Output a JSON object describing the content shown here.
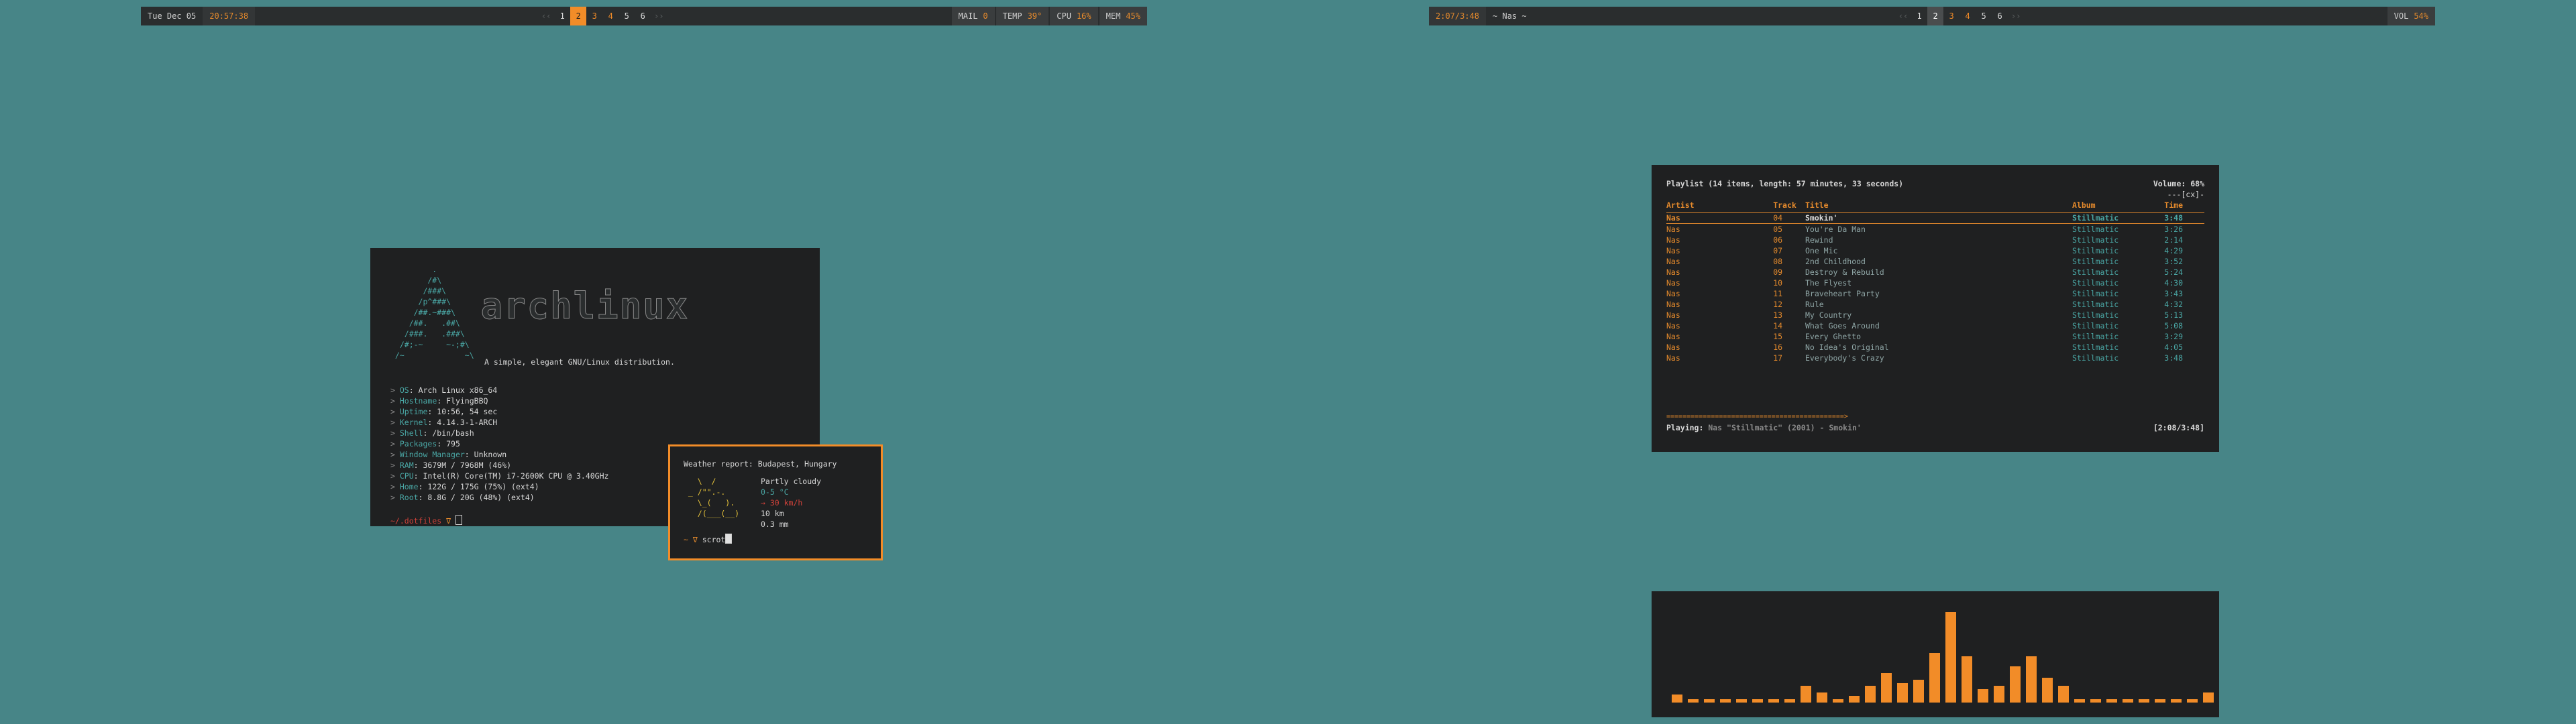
{
  "bar_left": {
    "date": "Tue Dec 05",
    "time": "20:57:38",
    "ws_left_arrow": "‹‹",
    "ws_right_arrow": "››",
    "workspaces": [
      "1",
      "2",
      "3",
      "4",
      "5",
      "6"
    ],
    "mail_label": "MAIL",
    "mail_value": "0",
    "temp_label": "TEMP",
    "temp_value": "39°",
    "cpu_label": "CPU",
    "cpu_value": "16%",
    "mem_label": "MEM",
    "mem_value": "45%"
  },
  "bar_right": {
    "track_time": "2:07/3:48",
    "title": "~ Nas ~",
    "ws_left_arrow": "‹‹",
    "ws_right_arrow": "››",
    "workspaces": [
      "1",
      "2",
      "3",
      "4",
      "5",
      "6"
    ],
    "vol_label": "VOL",
    "vol_value": "54%"
  },
  "neofetch": {
    "logo_text": "archlinux",
    "tagline": "A simple, elegant GNU/Linux distribution.",
    "info": [
      {
        "label": "OS",
        "value": "Arch Linux x86_64"
      },
      {
        "label": "Hostname",
        "value": "FlyingBBQ"
      },
      {
        "label": "Uptime",
        "value": "10:56, 54 sec"
      },
      {
        "label": "Kernel",
        "value": "4.14.3-1-ARCH"
      },
      {
        "label": "Shell",
        "value": "/bin/bash"
      },
      {
        "label": "Packages",
        "value": "795"
      },
      {
        "label": "Window Manager",
        "value": "Unknown"
      },
      {
        "label": "RAM",
        "value": "3679M / 7968M (46%)"
      },
      {
        "label": "CPU",
        "value": "Intel(R) Core(TM) i7-2600K CPU @ 3.40GHz"
      },
      {
        "label": "Home",
        "value": "122G / 175G (75%) (ext4)"
      },
      {
        "label": "Root",
        "value": "8.8G / 20G (48%) (ext4)"
      }
    ],
    "prompt_dir": "~/.dotfiles",
    "prompt_symbol": "∇"
  },
  "weather": {
    "title": "Weather report: Budapest, Hungary",
    "condition": "Partly cloudy",
    "temp": "0-5 °C",
    "wind": "→ 30 km/h",
    "visibility": "10 km",
    "precip": "0.3 mm",
    "prompt_symbol": "~ ∇",
    "command": "scrot"
  },
  "ncmpcpp": {
    "header": "Playlist (14 items, length: 57 minutes, 33 seconds)",
    "volume": "Volume: 68%",
    "flags": "---[cx]-",
    "columns": {
      "artist": "Artist",
      "track": "Track",
      "title": "Title",
      "album": "Album",
      "time": "Time"
    },
    "rows": [
      {
        "artist": "Nas",
        "track": "04",
        "title": "Smokin'",
        "album": "Stillmatic",
        "time": "3:48",
        "current": true
      },
      {
        "artist": "Nas",
        "track": "05",
        "title": "You're Da Man",
        "album": "Stillmatic",
        "time": "3:26"
      },
      {
        "artist": "Nas",
        "track": "06",
        "title": "Rewind",
        "album": "Stillmatic",
        "time": "2:14"
      },
      {
        "artist": "Nas",
        "track": "07",
        "title": "One Mic",
        "album": "Stillmatic",
        "time": "4:29"
      },
      {
        "artist": "Nas",
        "track": "08",
        "title": "2nd Childhood",
        "album": "Stillmatic",
        "time": "3:52"
      },
      {
        "artist": "Nas",
        "track": "09",
        "title": "Destroy & Rebuild",
        "album": "Stillmatic",
        "time": "5:24"
      },
      {
        "artist": "Nas",
        "track": "10",
        "title": "The Flyest",
        "album": "Stillmatic",
        "time": "4:30"
      },
      {
        "artist": "Nas",
        "track": "11",
        "title": "Braveheart Party",
        "album": "Stillmatic",
        "time": "3:43"
      },
      {
        "artist": "Nas",
        "track": "12",
        "title": "Rule",
        "album": "Stillmatic",
        "time": "4:32"
      },
      {
        "artist": "Nas",
        "track": "13",
        "title": "My Country",
        "album": "Stillmatic",
        "time": "5:13"
      },
      {
        "artist": "Nas",
        "track": "14",
        "title": "What Goes Around",
        "album": "Stillmatic",
        "time": "5:08"
      },
      {
        "artist": "Nas",
        "track": "15",
        "title": "Every Ghetto",
        "album": "Stillmatic",
        "time": "3:29"
      },
      {
        "artist": "Nas",
        "track": "16",
        "title": "No Idea's Original",
        "album": "Stillmatic",
        "time": "4:05"
      },
      {
        "artist": "Nas",
        "track": "17",
        "title": "Everybody's Crazy",
        "album": "Stillmatic",
        "time": "3:48"
      }
    ],
    "progress_fraction": 0.55,
    "playing_label": "Playing:",
    "playing_value": "Nas \"Stillmatic\" (2001) - Smokin'",
    "playing_time": "[2:08/3:48]"
  },
  "visualizer": {
    "levels": [
      0.05,
      0.02,
      0.02,
      0.02,
      0.02,
      0.02,
      0.02,
      0.02,
      0.1,
      0.06,
      0.02,
      0.04,
      0.1,
      0.18,
      0.12,
      0.14,
      0.3,
      0.55,
      0.28,
      0.08,
      0.1,
      0.22,
      0.28,
      0.15,
      0.1,
      0.02,
      0.02,
      0.02,
      0.02,
      0.02,
      0.02,
      0.02,
      0.02,
      0.06
    ],
    "color": "#f28c28"
  }
}
